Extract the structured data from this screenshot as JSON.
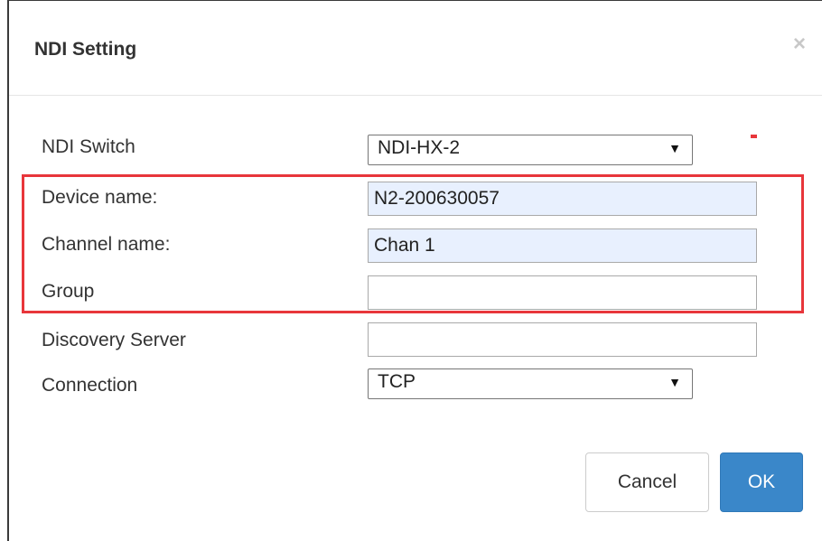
{
  "dialog": {
    "title": "NDI Setting",
    "close_symbol": "×"
  },
  "fields": {
    "ndi_switch": {
      "label": "NDI Switch",
      "value": "NDI-HX-2"
    },
    "device_name": {
      "label": "Device name:",
      "value": "N2-200630057"
    },
    "channel_name": {
      "label": "Channel name:",
      "value": "Chan 1"
    },
    "group": {
      "label": "Group",
      "value": ""
    },
    "discovery_server": {
      "label": "Discovery Server",
      "value": ""
    },
    "connection": {
      "label": "Connection",
      "value": "TCP"
    }
  },
  "buttons": {
    "cancel": "Cancel",
    "ok": "OK"
  },
  "colors": {
    "highlight": "#e8363b",
    "ok_button": "#3a87c9",
    "autofill_bg": "#e8f0fe"
  },
  "icons": {
    "close": "close-icon",
    "dropdown": "dropdown-arrow-icon"
  }
}
